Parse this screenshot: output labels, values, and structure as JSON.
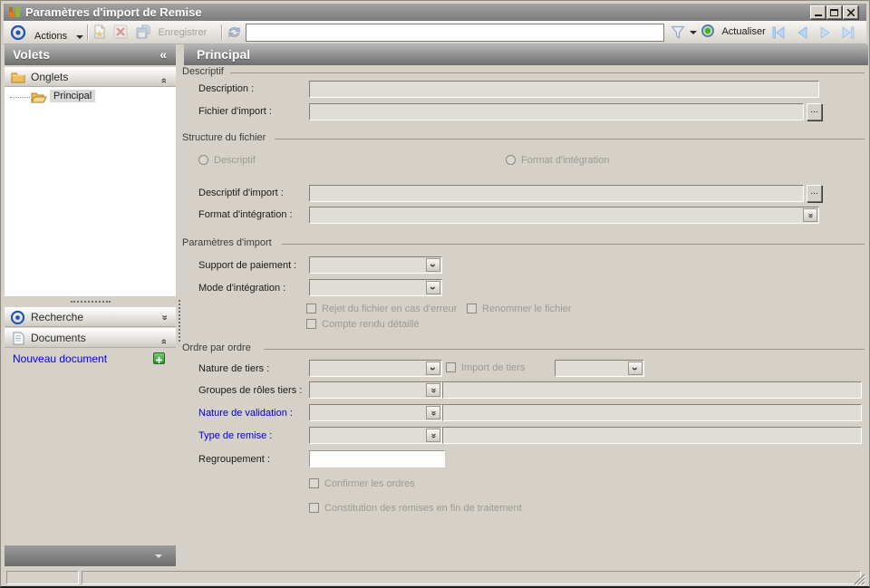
{
  "window": {
    "title": "Paramètres d'import de Remise"
  },
  "toolbar": {
    "actions_label": "Actions",
    "save_label": "Enregistrer",
    "search_value": "",
    "refresh_label": "Actualiser"
  },
  "sidebar": {
    "header": "Volets",
    "onglets_label": "Onglets",
    "tree_selected_item": "Principal",
    "recherche_label": "Recherche",
    "documents_label": "Documents",
    "new_document_label": "Nouveau document"
  },
  "main": {
    "header": "Principal",
    "browse_label": "...",
    "groups": {
      "descriptif": {
        "title": "Descriptif",
        "description_label": "Description :",
        "description_value": "",
        "fichier_import_label": "Fichier d'import :",
        "fichier_import_value": ""
      },
      "structure": {
        "title": "Structure du fichier",
        "radio_descriptif_label": "Descriptif",
        "radio_format_label": "Format d'intégration",
        "descriptif_import_label": "Descriptif d'import :",
        "descriptif_import_value": "",
        "format_integration_label": "Format d'intégration :",
        "format_integration_value": ""
      },
      "parametres": {
        "title": "Paramètres d'import",
        "support_paiement_label": "Support de paiement :",
        "support_paiement_value": "",
        "mode_integration_label": "Mode d'intégration :",
        "mode_integration_value": "",
        "cb_rejet_label": "Rejet du fichier en cas d'erreur",
        "cb_renommer_label": "Renommer le fichier",
        "cb_compte_rendu_label": "Compte rendu détaillé"
      },
      "ordre": {
        "title": "Ordre par ordre",
        "nature_tiers_label": "Nature de tiers :",
        "nature_tiers_value": "",
        "cb_import_tiers_label": "Import de tiers",
        "import_tiers_value": "",
        "groupes_roles_label": "Groupes de rôles tiers :",
        "groupes_roles_value": "",
        "nature_validation_label": "Nature de validation :",
        "nature_validation_value": "",
        "type_remise_label": "Type de remise :",
        "type_remise_value": "",
        "regroupement_label": "Regroupement :",
        "regroupement_value": "",
        "cb_confirmer_label": "Confirmer les ordres",
        "cb_constitution_label": "Constitution des remises en fin de traitement"
      }
    }
  },
  "icons": {
    "collapse_glyph": "«",
    "double_chevron_glyph": "»",
    "single_chevron_glyph": "›"
  },
  "colors": {
    "accent_blue_label": "#0000cc",
    "link_blue": "#0000ee",
    "header_gray": "#8a8a8a",
    "form_background": "#d5d1c9",
    "new_button_green": "#3fa33f"
  }
}
